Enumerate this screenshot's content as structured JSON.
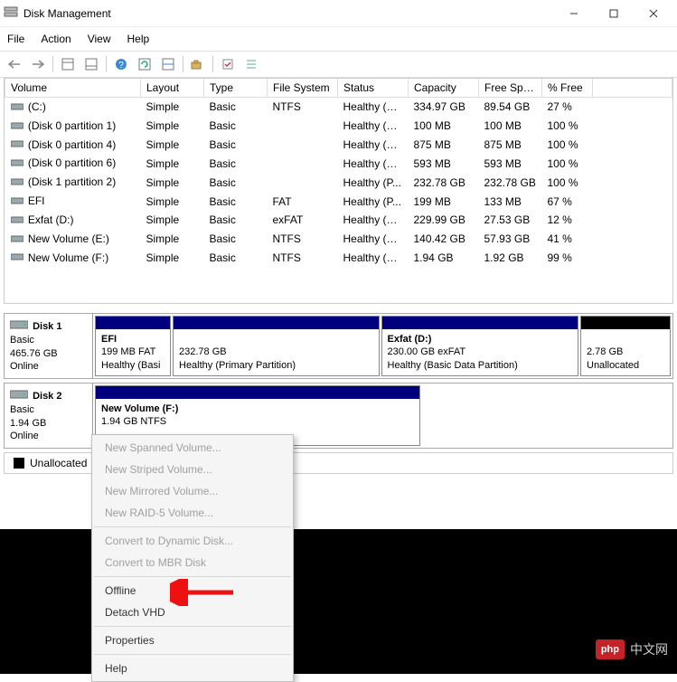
{
  "window": {
    "title": "Disk Management"
  },
  "menu": {
    "items": [
      "File",
      "Action",
      "View",
      "Help"
    ]
  },
  "toolbar": {},
  "columns": {
    "volume": "Volume",
    "layout": "Layout",
    "type": "Type",
    "fs": "File System",
    "status": "Status",
    "capacity": "Capacity",
    "free": "Free Spa...",
    "pct": "% Free"
  },
  "volumes": [
    {
      "name": "(C:)",
      "layout": "Simple",
      "type": "Basic",
      "fs": "NTFS",
      "status": "Healthy (B...",
      "cap": "334.97 GB",
      "free": "89.54 GB",
      "pct": "27 %"
    },
    {
      "name": "(Disk 0 partition 1)",
      "layout": "Simple",
      "type": "Basic",
      "fs": "",
      "status": "Healthy (E...",
      "cap": "100 MB",
      "free": "100 MB",
      "pct": "100 %"
    },
    {
      "name": "(Disk 0 partition 4)",
      "layout": "Simple",
      "type": "Basic",
      "fs": "",
      "status": "Healthy (R...",
      "cap": "875 MB",
      "free": "875 MB",
      "pct": "100 %"
    },
    {
      "name": "(Disk 0 partition 6)",
      "layout": "Simple",
      "type": "Basic",
      "fs": "",
      "status": "Healthy (R...",
      "cap": "593 MB",
      "free": "593 MB",
      "pct": "100 %"
    },
    {
      "name": "(Disk 1 partition 2)",
      "layout": "Simple",
      "type": "Basic",
      "fs": "",
      "status": "Healthy (P...",
      "cap": "232.78 GB",
      "free": "232.78 GB",
      "pct": "100 %"
    },
    {
      "name": "EFI",
      "layout": "Simple",
      "type": "Basic",
      "fs": "FAT",
      "status": "Healthy (P...",
      "cap": "199 MB",
      "free": "133 MB",
      "pct": "67 %"
    },
    {
      "name": "Exfat (D:)",
      "layout": "Simple",
      "type": "Basic",
      "fs": "exFAT",
      "status": "Healthy (B...",
      "cap": "229.99 GB",
      "free": "27.53 GB",
      "pct": "12 %"
    },
    {
      "name": "New Volume (E:)",
      "layout": "Simple",
      "type": "Basic",
      "fs": "NTFS",
      "status": "Healthy (B...",
      "cap": "140.42 GB",
      "free": "57.93 GB",
      "pct": "41 %"
    },
    {
      "name": "New Volume (F:)",
      "layout": "Simple",
      "type": "Basic",
      "fs": "NTFS",
      "status": "Healthy (B...",
      "cap": "1.94 GB",
      "free": "1.92 GB",
      "pct": "99 %"
    }
  ],
  "disks": {
    "d1": {
      "name": "Disk 1",
      "type": "Basic",
      "size": "465.76 GB",
      "state": "Online",
      "parts": {
        "p0": {
          "title": "EFI",
          "line2": "199 MB FAT",
          "line3": "Healthy (Basi"
        },
        "p1": {
          "title": "",
          "line2": "232.78 GB",
          "line3": "Healthy (Primary Partition)"
        },
        "p2": {
          "title": "Exfat  (D:)",
          "line2": "230.00 GB exFAT",
          "line3": "Healthy (Basic Data Partition)"
        },
        "p3": {
          "title": "",
          "line2": "2.78 GB",
          "line3": "Unallocated"
        }
      }
    },
    "d2": {
      "name": "Disk 2",
      "type": "Basic",
      "size": "1.94 GB",
      "state": "Online",
      "parts": {
        "p0": {
          "title": "New Volume  (F:)",
          "line2": "1.94 GB NTFS"
        }
      }
    }
  },
  "legend": {
    "unallocated": "Unallocated"
  },
  "context_menu": {
    "items": {
      "i0": "New Spanned Volume...",
      "i1": "New Striped Volume...",
      "i2": "New Mirrored Volume...",
      "i3": "New RAID-5 Volume...",
      "i4": "Convert to Dynamic Disk...",
      "i5": "Convert to MBR Disk",
      "i6": "Offline",
      "i7": "Detach VHD",
      "i8": "Properties",
      "i9": "Help"
    }
  },
  "watermark": {
    "badge": "php",
    "text": "中文网"
  }
}
